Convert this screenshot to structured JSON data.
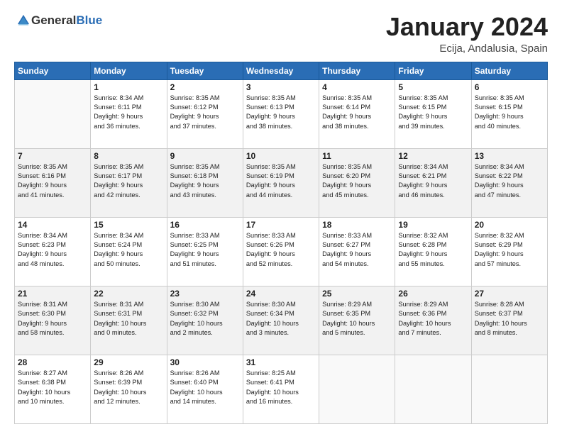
{
  "header": {
    "logo_general": "General",
    "logo_blue": "Blue",
    "month": "January 2024",
    "location": "Ecija, Andalusia, Spain"
  },
  "weekdays": [
    "Sunday",
    "Monday",
    "Tuesday",
    "Wednesday",
    "Thursday",
    "Friday",
    "Saturday"
  ],
  "weeks": [
    [
      {
        "day": "",
        "text": ""
      },
      {
        "day": "1",
        "text": "Sunrise: 8:34 AM\nSunset: 6:11 PM\nDaylight: 9 hours\nand 36 minutes."
      },
      {
        "day": "2",
        "text": "Sunrise: 8:35 AM\nSunset: 6:12 PM\nDaylight: 9 hours\nand 37 minutes."
      },
      {
        "day": "3",
        "text": "Sunrise: 8:35 AM\nSunset: 6:13 PM\nDaylight: 9 hours\nand 38 minutes."
      },
      {
        "day": "4",
        "text": "Sunrise: 8:35 AM\nSunset: 6:14 PM\nDaylight: 9 hours\nand 38 minutes."
      },
      {
        "day": "5",
        "text": "Sunrise: 8:35 AM\nSunset: 6:15 PM\nDaylight: 9 hours\nand 39 minutes."
      },
      {
        "day": "6",
        "text": "Sunrise: 8:35 AM\nSunset: 6:15 PM\nDaylight: 9 hours\nand 40 minutes."
      }
    ],
    [
      {
        "day": "7",
        "text": "Sunrise: 8:35 AM\nSunset: 6:16 PM\nDaylight: 9 hours\nand 41 minutes."
      },
      {
        "day": "8",
        "text": "Sunrise: 8:35 AM\nSunset: 6:17 PM\nDaylight: 9 hours\nand 42 minutes."
      },
      {
        "day": "9",
        "text": "Sunrise: 8:35 AM\nSunset: 6:18 PM\nDaylight: 9 hours\nand 43 minutes."
      },
      {
        "day": "10",
        "text": "Sunrise: 8:35 AM\nSunset: 6:19 PM\nDaylight: 9 hours\nand 44 minutes."
      },
      {
        "day": "11",
        "text": "Sunrise: 8:35 AM\nSunset: 6:20 PM\nDaylight: 9 hours\nand 45 minutes."
      },
      {
        "day": "12",
        "text": "Sunrise: 8:34 AM\nSunset: 6:21 PM\nDaylight: 9 hours\nand 46 minutes."
      },
      {
        "day": "13",
        "text": "Sunrise: 8:34 AM\nSunset: 6:22 PM\nDaylight: 9 hours\nand 47 minutes."
      }
    ],
    [
      {
        "day": "14",
        "text": "Sunrise: 8:34 AM\nSunset: 6:23 PM\nDaylight: 9 hours\nand 48 minutes."
      },
      {
        "day": "15",
        "text": "Sunrise: 8:34 AM\nSunset: 6:24 PM\nDaylight: 9 hours\nand 50 minutes."
      },
      {
        "day": "16",
        "text": "Sunrise: 8:33 AM\nSunset: 6:25 PM\nDaylight: 9 hours\nand 51 minutes."
      },
      {
        "day": "17",
        "text": "Sunrise: 8:33 AM\nSunset: 6:26 PM\nDaylight: 9 hours\nand 52 minutes."
      },
      {
        "day": "18",
        "text": "Sunrise: 8:33 AM\nSunset: 6:27 PM\nDaylight: 9 hours\nand 54 minutes."
      },
      {
        "day": "19",
        "text": "Sunrise: 8:32 AM\nSunset: 6:28 PM\nDaylight: 9 hours\nand 55 minutes."
      },
      {
        "day": "20",
        "text": "Sunrise: 8:32 AM\nSunset: 6:29 PM\nDaylight: 9 hours\nand 57 minutes."
      }
    ],
    [
      {
        "day": "21",
        "text": "Sunrise: 8:31 AM\nSunset: 6:30 PM\nDaylight: 9 hours\nand 58 minutes."
      },
      {
        "day": "22",
        "text": "Sunrise: 8:31 AM\nSunset: 6:31 PM\nDaylight: 10 hours\nand 0 minutes."
      },
      {
        "day": "23",
        "text": "Sunrise: 8:30 AM\nSunset: 6:32 PM\nDaylight: 10 hours\nand 2 minutes."
      },
      {
        "day": "24",
        "text": "Sunrise: 8:30 AM\nSunset: 6:34 PM\nDaylight: 10 hours\nand 3 minutes."
      },
      {
        "day": "25",
        "text": "Sunrise: 8:29 AM\nSunset: 6:35 PM\nDaylight: 10 hours\nand 5 minutes."
      },
      {
        "day": "26",
        "text": "Sunrise: 8:29 AM\nSunset: 6:36 PM\nDaylight: 10 hours\nand 7 minutes."
      },
      {
        "day": "27",
        "text": "Sunrise: 8:28 AM\nSunset: 6:37 PM\nDaylight: 10 hours\nand 8 minutes."
      }
    ],
    [
      {
        "day": "28",
        "text": "Sunrise: 8:27 AM\nSunset: 6:38 PM\nDaylight: 10 hours\nand 10 minutes."
      },
      {
        "day": "29",
        "text": "Sunrise: 8:26 AM\nSunset: 6:39 PM\nDaylight: 10 hours\nand 12 minutes."
      },
      {
        "day": "30",
        "text": "Sunrise: 8:26 AM\nSunset: 6:40 PM\nDaylight: 10 hours\nand 14 minutes."
      },
      {
        "day": "31",
        "text": "Sunrise: 8:25 AM\nSunset: 6:41 PM\nDaylight: 10 hours\nand 16 minutes."
      },
      {
        "day": "",
        "text": ""
      },
      {
        "day": "",
        "text": ""
      },
      {
        "day": "",
        "text": ""
      }
    ]
  ]
}
